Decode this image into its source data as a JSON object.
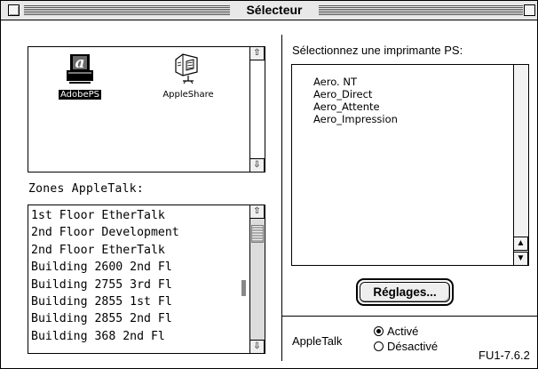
{
  "window": {
    "title": "Sélecteur"
  },
  "printers_pane": {
    "items": [
      {
        "label": "AdobePS",
        "icon": "adobeps-printer-icon",
        "selected": true
      },
      {
        "label": "AppleShare",
        "icon": "appleshare-server-icon",
        "selected": false
      }
    ]
  },
  "zones": {
    "label": "Zones AppleTalk:",
    "items": [
      "1st Floor EtherTalk",
      "2nd Floor Development",
      "2nd Floor EtherTalk",
      "Building 2600 2nd Fl",
      "Building 2755 3rd Fl",
      "Building 2855 1st Fl",
      "Building 2855 2nd Fl",
      "Building 368 2nd Fl"
    ]
  },
  "printer_select": {
    "label": "Sélectionnez une imprimante PS:",
    "items": [
      "Aero. NT",
      "Aero_Direct",
      "Aero_Attente",
      "Aero_Impression"
    ]
  },
  "setup_button": {
    "label": "Réglages..."
  },
  "appletalk": {
    "label": "AppleTalk",
    "options": [
      {
        "label": "Activé",
        "checked": true
      },
      {
        "label": "Désactivé",
        "checked": false
      }
    ]
  },
  "version": "FU1-7.6.2"
}
